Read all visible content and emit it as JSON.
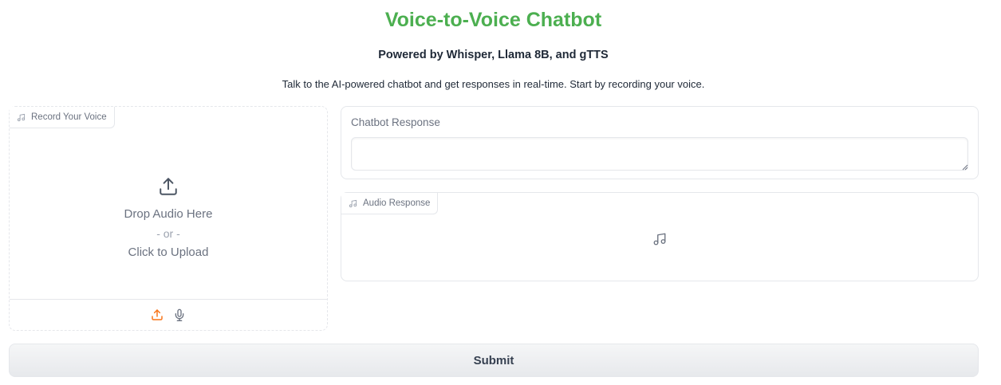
{
  "header": {
    "title": "Voice-to-Voice Chatbot",
    "subtitle": "Powered by Whisper, Llama 8B, and gTTS",
    "description": "Talk to the AI-powered chatbot and get responses in real-time. Start by recording your voice."
  },
  "input_audio": {
    "label": "Record Your Voice",
    "label_icon": "music-note-icon",
    "drop_text": "Drop Audio Here",
    "or_text": "- or -",
    "click_text": "Click to Upload",
    "upload_icon": "upload-icon",
    "source_options": [
      {
        "name": "upload",
        "icon": "upload-icon",
        "selected": true
      },
      {
        "name": "microphone",
        "icon": "microphone-icon",
        "selected": false
      }
    ]
  },
  "chat_response": {
    "label": "Chatbot Response",
    "value": ""
  },
  "audio_response": {
    "label": "Audio Response",
    "label_icon": "music-note-icon",
    "empty_icon": "music-note-icon"
  },
  "submit": {
    "label": "Submit"
  },
  "colors": {
    "title": "#4caf50",
    "accent_orange": "#f97316",
    "border": "#e5e7eb",
    "muted_text": "#6b7280"
  }
}
